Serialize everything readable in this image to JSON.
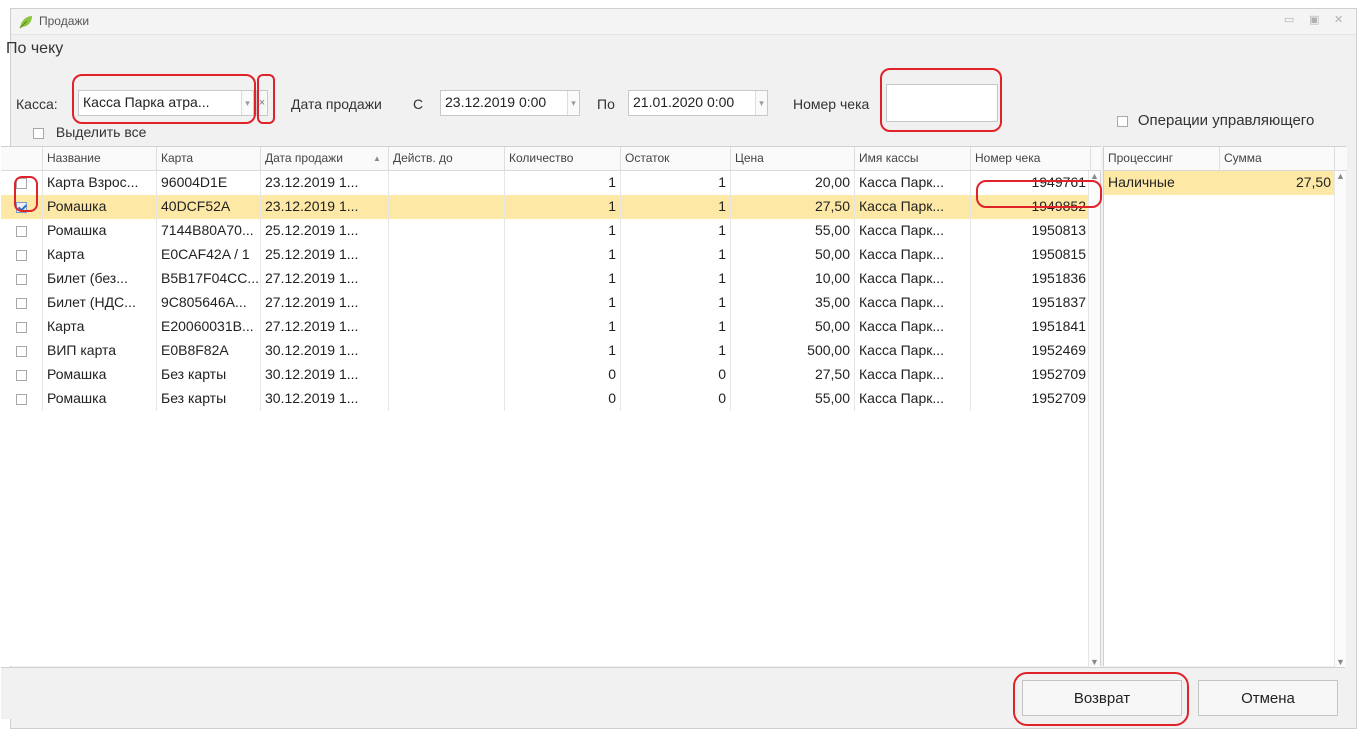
{
  "window": {
    "title": "Продажи",
    "controls": [
      "▭",
      "▣",
      "✕"
    ]
  },
  "section_title": "По чеку",
  "filters": {
    "kassa_label": "Касса:",
    "kassa_value": "Касса Парка атра...",
    "kassa_clear": "×",
    "date_label": "Дата продажи",
    "from_label": "С",
    "from_value": "23.12.2019 0:00",
    "to_label": "По",
    "to_value": "21.01.2020 0:00",
    "check_number_label": "Номер чека",
    "check_number_value": "",
    "select_all_label": "Выделить все",
    "manager_ops_label": "Операции управляющего"
  },
  "table": {
    "headers": [
      "Название",
      "Карта",
      "Дата продажи",
      "Действ. до",
      "Количество",
      "Остаток",
      "Цена",
      "Имя кассы",
      "Номер чека"
    ],
    "sort_indicator": "▲",
    "rows": [
      {
        "checked": false,
        "selected": false,
        "name": "Карта Взрос...",
        "card": "96004D1E",
        "date": "23.12.2019 1...",
        "valid_to": "",
        "qty": "1",
        "rest": "1",
        "price": "20,00",
        "kassa": "Касса Парк...",
        "check": "1949761"
      },
      {
        "checked": true,
        "selected": true,
        "name": "Ромашка",
        "card": "40DCF52A",
        "date": "23.12.2019 1...",
        "valid_to": "",
        "qty": "1",
        "rest": "1",
        "price": "27,50",
        "kassa": "Касса Парк...",
        "check": "1949852"
      },
      {
        "checked": false,
        "selected": false,
        "name": "Ромашка",
        "card": "7144B80A70...",
        "date": "25.12.2019 1...",
        "valid_to": "",
        "qty": "1",
        "rest": "1",
        "price": "55,00",
        "kassa": "Касса Парк...",
        "check": "1950813"
      },
      {
        "checked": false,
        "selected": false,
        "name": "Карта",
        "card": "E0CAF42A / 1",
        "date": "25.12.2019 1...",
        "valid_to": "",
        "qty": "1",
        "rest": "1",
        "price": "50,00",
        "kassa": "Касса Парк...",
        "check": "1950815"
      },
      {
        "checked": false,
        "selected": false,
        "name": "Билет (без...",
        "card": "B5B17F04CC...",
        "date": "27.12.2019 1...",
        "valid_to": "",
        "qty": "1",
        "rest": "1",
        "price": "10,00",
        "kassa": "Касса Парк...",
        "check": "1951836"
      },
      {
        "checked": false,
        "selected": false,
        "name": "Билет (НДС...",
        "card": "9C805646A...",
        "date": "27.12.2019 1...",
        "valid_to": "",
        "qty": "1",
        "rest": "1",
        "price": "35,00",
        "kassa": "Касса Парк...",
        "check": "1951837"
      },
      {
        "checked": false,
        "selected": false,
        "name": "Карта",
        "card": "E20060031B...",
        "date": "27.12.2019 1...",
        "valid_to": "",
        "qty": "1",
        "rest": "1",
        "price": "50,00",
        "kassa": "Касса Парк...",
        "check": "1951841"
      },
      {
        "checked": false,
        "selected": false,
        "name": "ВИП карта",
        "card": "E0B8F82A",
        "date": "30.12.2019 1...",
        "valid_to": "",
        "qty": "1",
        "rest": "1",
        "price": "500,00",
        "kassa": "Касса Парк...",
        "check": "1952469"
      },
      {
        "checked": false,
        "selected": false,
        "name": "Ромашка",
        "card": "Без карты",
        "date": "30.12.2019 1...",
        "valid_to": "",
        "qty": "0",
        "rest": "0",
        "price": "27,50",
        "kassa": "Касса Парк...",
        "check": "1952709"
      },
      {
        "checked": false,
        "selected": false,
        "name": "Ромашка",
        "card": "Без карты",
        "date": "30.12.2019 1...",
        "valid_to": "",
        "qty": "0",
        "rest": "0",
        "price": "55,00",
        "kassa": "Касса Парк...",
        "check": "1952709"
      }
    ]
  },
  "payments": {
    "headers": [
      "Процессинг",
      "Сумма"
    ],
    "rows": [
      {
        "processing": "Наличные",
        "amount": "27,50"
      }
    ]
  },
  "buttons": {
    "return": "Возврат",
    "cancel": "Отмена"
  },
  "colors": {
    "selected_row": "#fde8a6",
    "annotation_red": "#e0222a"
  }
}
